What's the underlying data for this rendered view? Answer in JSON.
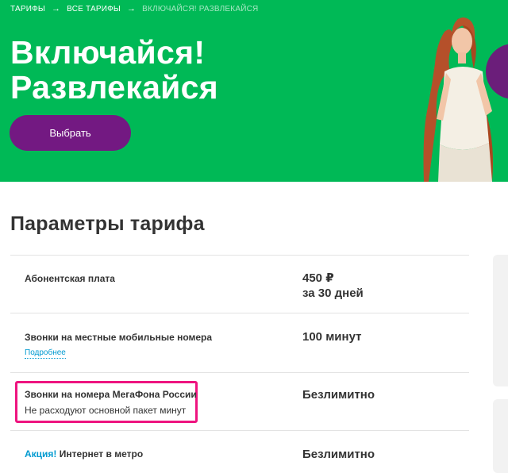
{
  "breadcrumb": {
    "items": [
      "ТАРИФЫ",
      "ВСЕ ТАРИФЫ"
    ],
    "current": "ВКЛЮЧАЙСЯ! РАЗВЛЕКАЙСЯ",
    "separator": "→"
  },
  "hero": {
    "title_line1": "Включайся!",
    "title_line2": "Развлекайся",
    "cta_label": "Выбрать"
  },
  "params": {
    "title": "Параметры тарифа",
    "rows": [
      {
        "name": "Абонентская плата",
        "value_line1": "450 ₽",
        "value_line2": "за 30 дней"
      },
      {
        "name": "Звонки на местные мобильные номера",
        "value": "100 минут",
        "link": "Подробнее"
      },
      {
        "name": "Звонки на номера МегаФона России",
        "sub": "Не расходуют основной пакет минут",
        "value": "Безлимитно"
      },
      {
        "promo": "Акция!",
        "name": "Интернет в метро",
        "value": "Безлимитно"
      }
    ]
  },
  "colors": {
    "brand_green": "#00b956",
    "brand_purple": "#731982",
    "highlight_pink": "#ee147f",
    "link_blue": "#009ad0"
  }
}
